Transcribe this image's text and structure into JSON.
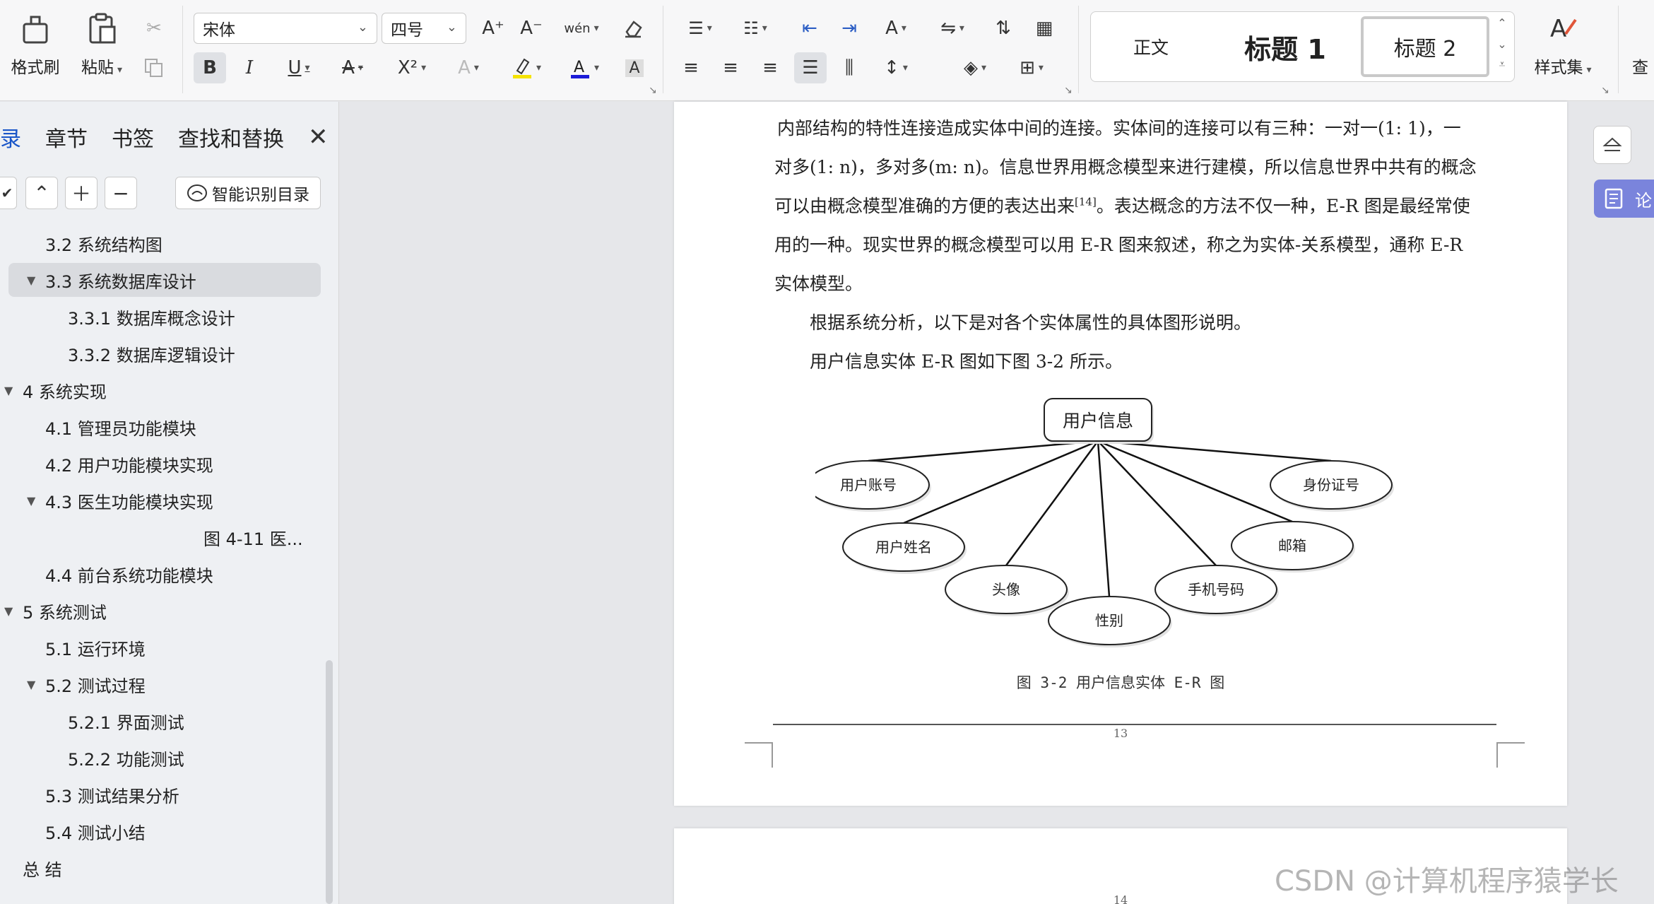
{
  "ribbon": {
    "format_painter": "格式刷",
    "paste": "粘贴",
    "font_name": "宋体",
    "font_size": "四号",
    "grow_font": "A⁺",
    "shrink_font": "A⁻",
    "phonetic": "wén",
    "bold": "B",
    "italic": "I",
    "underline": "U",
    "strike": "A",
    "superscript": "X²",
    "styles": {
      "normal": "正文",
      "heading1": "标题 1",
      "heading2": "标题 2"
    },
    "styles_set": "样式集",
    "find_partial": "查"
  },
  "nav": {
    "tabs": [
      "目录",
      "章节",
      "书签",
      "查找和替换"
    ],
    "tab_active_visible": "录",
    "smart_toc": "智能识别目录",
    "toc": [
      {
        "label": "3.2  系统结构图",
        "level": 2,
        "arrow": false,
        "selected": false
      },
      {
        "label": "3.3  系统数据库设计",
        "level": 2,
        "arrow": true,
        "selected": true
      },
      {
        "label": "3.3.1  数据库概念设计",
        "level": 3,
        "arrow": false,
        "selected": false
      },
      {
        "label": "3.3.2  数据库逻辑设计",
        "level": 3,
        "arrow": false,
        "selected": false
      },
      {
        "label": "4  系统实现",
        "level": 1,
        "arrow": true,
        "selected": false
      },
      {
        "label": "4.1    管理员功能模块",
        "level": 2,
        "arrow": false,
        "selected": false
      },
      {
        "label": "4.2 用户功能模块实现",
        "level": 2,
        "arrow": false,
        "selected": false
      },
      {
        "label": "4.3 医生功能模块实现",
        "level": 2,
        "arrow": true,
        "selected": false
      },
      {
        "label": "图 4-11  医...",
        "level": 4,
        "arrow": false,
        "selected": false
      },
      {
        "label": "4.4 前台系统功能模块",
        "level": 2,
        "arrow": false,
        "selected": false
      },
      {
        "label": "5  系统测试",
        "level": 1,
        "arrow": true,
        "selected": false
      },
      {
        "label": "5.1  运行环境",
        "level": 2,
        "arrow": false,
        "selected": false
      },
      {
        "label": "5.2  测试过程",
        "level": 2,
        "arrow": true,
        "selected": false
      },
      {
        "label": "5.2.1  界面测试",
        "level": 3,
        "arrow": false,
        "selected": false
      },
      {
        "label": "5.2.2  功能测试",
        "level": 3,
        "arrow": false,
        "selected": false
      },
      {
        "label": "5.3  测试结果分析",
        "level": 2,
        "arrow": false,
        "selected": false
      },
      {
        "label": "5.4  测试小结",
        "level": 2,
        "arrow": false,
        "selected": false
      },
      {
        "label": "总    结",
        "level": 1,
        "arrow": false,
        "selected": false
      }
    ]
  },
  "doc": {
    "lines": [
      "内部结构的特性连接造成实体中间的连接。实体间的连接可以有三种：一对一(1: 1)，一",
      "对多(1: n)，多对多(m: n)。信息世界用概念模型来进行建模，所以信息世界中共有的概念",
      "可以由概念模型准确的方便的表达出来",
      "用的一种。现实世界的概念模型可以用 E-R 图来叙述，称之为实体-关系模型，通称 E-R",
      "实体模型。",
      "根据系统分析，以下是对各个实体属性的具体图形说明。",
      "用户信息实体 E-R 图如下图 3-2 所示。"
    ],
    "cite": "[14]",
    "line3_tail": "。表达概念的方法不仅一种，E-R 图是最经常使",
    "er": {
      "entity": "用户信息",
      "attributes": [
        "用户账号",
        "用户姓名",
        "头像",
        "性别",
        "手机号码",
        "邮箱",
        "身份证号"
      ]
    },
    "caption": "图 3-2  用户信息实体 E-R 图",
    "page_number": "13",
    "next_page_number": "14"
  },
  "side": {
    "partial_label": "论"
  },
  "watermark": "CSDN @计算机程序猿学长"
}
